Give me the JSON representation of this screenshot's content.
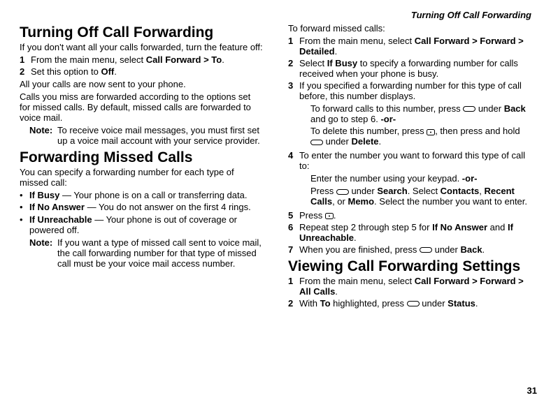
{
  "running_head": "Turning Off Call Forwarding",
  "page_number": "31",
  "left": {
    "h1a": "Turning Off Call Forwarding",
    "intro_a": "If you don't want all your calls forwarded, turn the feature off:",
    "list_a": [
      {
        "n": "1",
        "html": "From the main menu, select <b>Call Forward > To</b>."
      },
      {
        "n": "2",
        "html": "Set this option to <b>Off</b>."
      }
    ],
    "para_a1": "All your calls are now sent to your phone.",
    "para_a2": "Calls you miss are forwarded according to the options set for missed calls. By default, missed calls are forwarded to voice mail.",
    "note_a_label": "Note:",
    "note_a_body": "To receive voice mail messages, you must first set up a voice mail account with your service provider.",
    "h1b": "Forwarding Missed Calls",
    "intro_b": "You can specify a forwarding number for each type of missed call:",
    "bullets_b": [
      "<b>If Busy</b> — Your phone is on a call or transferring data.",
      "<b>If No Answer</b> — You do not answer on the first 4 rings.",
      "<b>If Unreachable</b> — Your phone is out of coverage or powered off."
    ],
    "note_b_label": "Note:",
    "note_b_body": "If you want a type of missed call sent to voice mail, the call forwarding number for that type of missed call must be your voice mail access number."
  },
  "right": {
    "intro": "To forward missed calls:",
    "list": [
      {
        "n": "1",
        "html": "From the main menu, select <b>Call Forward > Forward > Detailed</b>."
      },
      {
        "n": "2",
        "html": "Select <b>If Busy</b> to specify a forwarding number for calls received when your phone is busy."
      },
      {
        "n": "3",
        "html": "If you specified a forwarding number for this type of call before, this number displays.",
        "subs": [
          "To forward calls to this number, press <svg class='key' width='18' height='8'><rect x='0.5' y='0.5' width='17' height='7' rx='3.5' ry='3.5' fill='none' stroke='black'/></svg> under <b>Back</b> and go to step 6. <b>-or-</b>",
          "To delete this number, press <svg class='key' width='12' height='9'><rect x='0.5' y='0.5' width='11' height='8' rx='2' ry='2' fill='none' stroke='black'/><circle cx='6' cy='4.5' r='1' fill='black'/></svg>, then press and hold <svg class='key' width='18' height='8'><rect x='0.5' y='0.5' width='17' height='7' rx='3.5' ry='3.5' fill='none' stroke='black'/></svg> under <b>Delete</b>."
        ]
      },
      {
        "n": "4",
        "html": "To enter the number you want to forward this type of call to:",
        "subs": [
          "Enter the number using your keypad. <b>-or-</b>",
          "Press <svg class='key' width='18' height='8'><rect x='0.5' y='0.5' width='17' height='7' rx='3.5' ry='3.5' fill='none' stroke='black'/></svg> under <b>Search</b>. Select <b>Contacts</b>, <b>Recent Calls</b>, or <b>Memo</b>. Select the number you want to enter."
        ]
      },
      {
        "n": "5",
        "html": "Press <svg class='key' width='12' height='9'><rect x='0.5' y='0.5' width='11' height='8' rx='2' ry='2' fill='none' stroke='black'/><circle cx='6' cy='4.5' r='1' fill='black'/></svg>."
      },
      {
        "n": "6",
        "html": "Repeat step 2 through step 5 for <b>If No Answer</b> and <b>If Unreachable</b>."
      },
      {
        "n": "7",
        "html": "When you are finished, press <svg class='key' width='18' height='8'><rect x='0.5' y='0.5' width='17' height='7' rx='3.5' ry='3.5' fill='none' stroke='black'/></svg> under <b>Back</b>."
      }
    ],
    "h1c": "Viewing Call Forwarding Settings",
    "list_c": [
      {
        "n": "1",
        "html": "From the main menu, select <b>Call Forward > Forward > All Calls</b>."
      },
      {
        "n": "2",
        "html": "With <b>To</b> highlighted, press <svg class='key' width='18' height='8'><rect x='0.5' y='0.5' width='17' height='7' rx='3.5' ry='3.5' fill='none' stroke='black'/></svg> under <b>Status</b>."
      }
    ]
  }
}
